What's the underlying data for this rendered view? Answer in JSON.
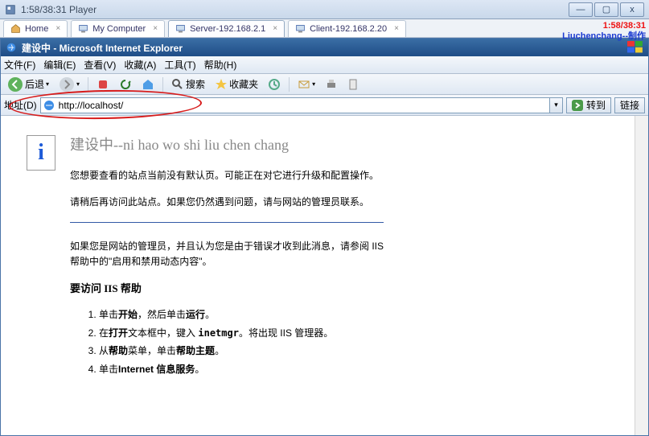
{
  "vmware": {
    "title": "1:58/38:31 Player",
    "buttons": {
      "min": "—",
      "max": "▢",
      "close": "x"
    }
  },
  "tabs": {
    "home": "Home",
    "mycomputer": "My Computer",
    "server": "Server-192.168.2.1",
    "client": "Client-192.168.2.20"
  },
  "overlay": {
    "time": "1:58/38:31",
    "credit": "Liuchenchang--制作"
  },
  "ie": {
    "title": "建设中 - Microsoft Internet Explorer",
    "menu": {
      "file": "文件(F)",
      "edit": "编辑(E)",
      "view": "查看(V)",
      "fav": "收藏(A)",
      "tools": "工具(T)",
      "help": "帮助(H)"
    },
    "toolbar": {
      "back": "后退",
      "search": "搜索",
      "favs": "收藏夹"
    },
    "address": {
      "label": "地址(D)",
      "value": "http://localhost/",
      "go": "转到",
      "links": "链接"
    }
  },
  "page": {
    "heading": "建设中--ni hao wo shi liu chen chang",
    "p1": "您想要查看的站点当前没有默认页。可能正在对它进行升级和配置操作。",
    "p2": "请稍后再访问此站点。如果您仍然遇到问题，请与网站的管理员联系。",
    "p3a": "如果您是网站的管理员，并且认为您是由于错误才收到此消息，请参阅 IIS",
    "p3b": "帮助中的\"启用和禁用动态内容\"。",
    "heading2": "要访问 IIS 帮助",
    "li1_a": "单击",
    "li1_b": "开始",
    "li1_c": "，然后单击",
    "li1_d": "运行",
    "li1_e": "。",
    "li2_a": "在",
    "li2_b": "打开",
    "li2_c": "文本框中，键入 ",
    "li2_code": "inetmgr",
    "li2_d": "。将出现 IIS 管理器。",
    "li3_a": "从",
    "li3_b": "帮助",
    "li3_c": "菜单，单击",
    "li3_d": "帮助主题",
    "li3_e": "。",
    "li4_a": "单击",
    "li4_b": "Internet 信息服务",
    "li4_c": "。"
  }
}
